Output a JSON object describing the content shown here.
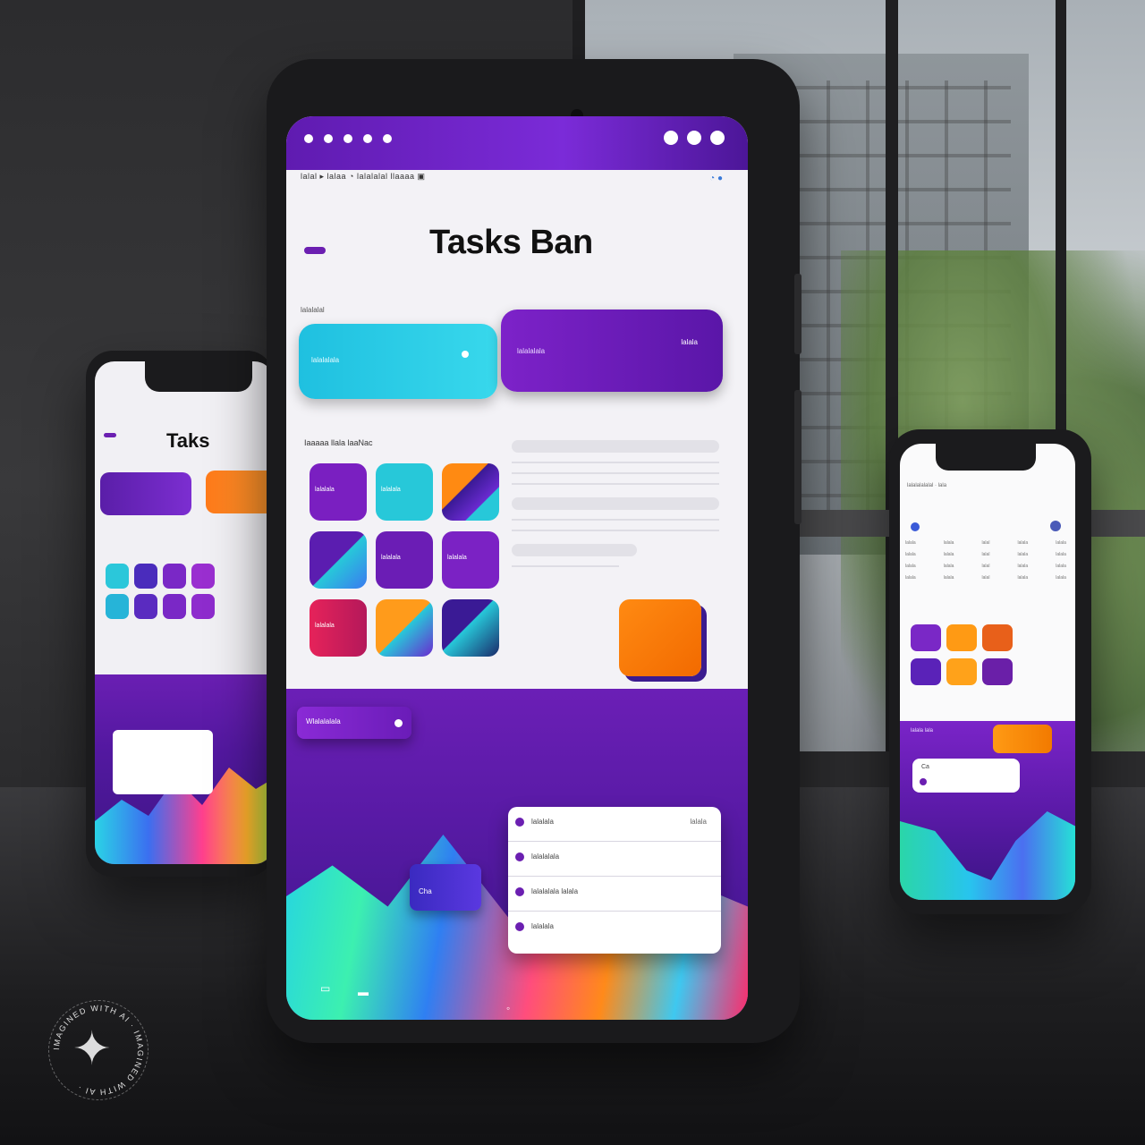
{
  "tablet": {
    "title": "Tasks Ban",
    "breadcrumb": "lalal  ▸  lalaa  ◔  lalalalal llaaaa  ▣",
    "section_label": "lalalalal",
    "filter_label": "Iaaaaa  llala laaNac",
    "cyan_card_label": "lalalalala",
    "purple_card_label": "lalalalala",
    "purple_card_action": "lalala",
    "tiles": [
      {
        "label": "lalalala",
        "color": "#7a1fc1"
      },
      {
        "label": "lalalala",
        "color": "#27c8d9"
      },
      {
        "label": "",
        "color": "#ff8a12"
      },
      {
        "label": "",
        "color": "#5b1db0"
      },
      {
        "label": "lalalala",
        "color": "#6b1db5"
      },
      {
        "label": "lalalala",
        "color": "#7b22c4"
      },
      {
        "label": "lalalala",
        "color": "#e6235a"
      },
      {
        "label": "",
        "color": "#ff9b1b"
      },
      {
        "label": "",
        "color": "#3a1a95"
      }
    ],
    "task_pill_label": "Wlalalalala",
    "mini_card_label": "Cha",
    "list_rows": [
      {
        "text": "lalalala",
        "meta": "lalala"
      },
      {
        "text": "lalalalala",
        "meta": ""
      },
      {
        "text": "lalalalala   lalala",
        "meta": ""
      },
      {
        "text": "lalalala",
        "meta": ""
      }
    ]
  },
  "left_phone": {
    "title": "Taks"
  },
  "right_phone": {
    "header": "lalalalalalal  ·  lala",
    "table_rows": [
      [
        "lalala",
        "lalala",
        "lalal",
        "lalala",
        "lalala"
      ],
      [
        "lalala",
        "lalala",
        "lalal",
        "lalala",
        "lalala"
      ],
      [
        "lalala",
        "lalala",
        "lalal",
        "lalala",
        "lalala"
      ],
      [
        "lalala",
        "lalala",
        "lalal",
        "lalala",
        "lalala"
      ]
    ],
    "bottom_label": "lalala lala",
    "input_text": "Ca"
  },
  "watermark": {
    "text": "IMAGINED WITH AI · IMAGINED WITH AI · "
  },
  "colors": {
    "brand_purple": "#6b1fb1",
    "accent_cyan": "#27c8d9",
    "accent_orange": "#ff8a12",
    "accent_pink": "#e6235a"
  }
}
